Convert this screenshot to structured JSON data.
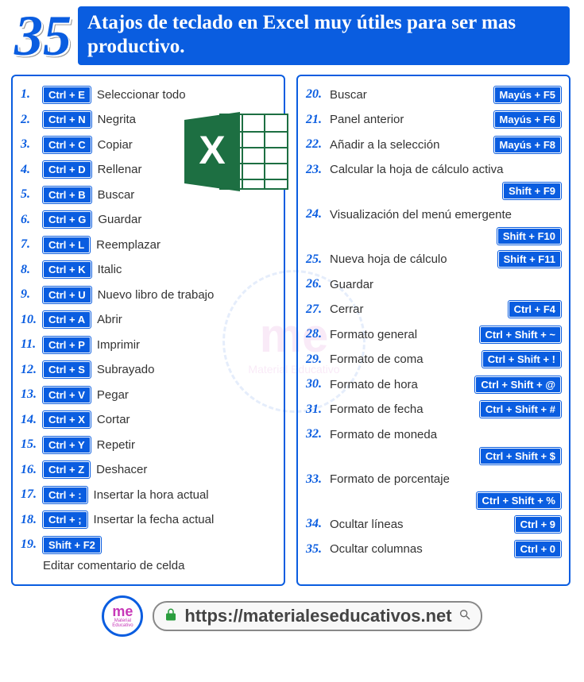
{
  "header": {
    "number": "35",
    "title": "Atajos de teclado en Excel muy útiles para ser mas productivo."
  },
  "leftColumn": [
    {
      "num": "1.",
      "key": "Ctrl + E",
      "desc": "Seleccionar todo"
    },
    {
      "num": "2.",
      "key": "Ctrl + N",
      "desc": "Negrita"
    },
    {
      "num": "3.",
      "key": "Ctrl + C",
      "desc": "Copiar"
    },
    {
      "num": "4.",
      "key": "Ctrl + D",
      "desc": "Rellenar"
    },
    {
      "num": "5.",
      "key": "Ctrl + B",
      "desc": "Buscar"
    },
    {
      "num": "6.",
      "key": "Ctrl + G",
      "desc": "Guardar"
    },
    {
      "num": "7.",
      "key": "Ctrl + L",
      "desc": "Reemplazar"
    },
    {
      "num": "8.",
      "key": "Ctrl + K",
      "desc": "Italic"
    },
    {
      "num": "9.",
      "key": "Ctrl + U",
      "desc": "Nuevo libro de trabajo"
    },
    {
      "num": "10.",
      "key": "Ctrl + A",
      "desc": "Abrir"
    },
    {
      "num": "11.",
      "key": "Ctrl + P",
      "desc": "Imprimir"
    },
    {
      "num": "12.",
      "key": "Ctrl + S",
      "desc": "Subrayado"
    },
    {
      "num": "13.",
      "key": "Ctrl + V",
      "desc": "Pegar"
    },
    {
      "num": "14.",
      "key": "Ctrl + X",
      "desc": "Cortar"
    },
    {
      "num": "15.",
      "key": "Ctrl + Y",
      "desc": "Repetir"
    },
    {
      "num": "16.",
      "key": "Ctrl + Z",
      "desc": "Deshacer"
    },
    {
      "num": "17.",
      "key": "Ctrl + :",
      "desc": "Insertar la hora actual"
    },
    {
      "num": "18.",
      "key": "Ctrl + ;",
      "desc": "Insertar la fecha actual"
    },
    {
      "num": "19.",
      "key": "Shift + F2",
      "desc": ""
    }
  ],
  "leftExtra": "Editar comentario de celda",
  "rightColumn": [
    {
      "num": "20.",
      "desc": "Buscar",
      "key": "Mayús + F5",
      "layout": "key-right"
    },
    {
      "num": "21.",
      "desc": "Panel anterior",
      "key": "Mayús + F6",
      "layout": "key-right"
    },
    {
      "num": "22.",
      "desc": "Añadir a la selección",
      "key": "Mayús + F8",
      "layout": "key-right"
    },
    {
      "num": "23.",
      "desc": "Calcular la hoja de cálculo activa",
      "key": "",
      "layout": "desc-only"
    },
    {
      "num": "",
      "desc": "",
      "key": "Shift + F9",
      "layout": "key-solo"
    },
    {
      "num": "24.",
      "desc": "Visualización del menú emergente",
      "key": "",
      "layout": "desc-only"
    },
    {
      "num": "",
      "desc": "",
      "key": "Shift + F10",
      "layout": "key-solo"
    },
    {
      "num": "25.",
      "desc": "Nueva hoja de cálculo",
      "key": "Shift + F11",
      "layout": "key-right"
    },
    {
      "num": "26.",
      "desc": "Guardar",
      "key": "",
      "layout": "desc-only"
    },
    {
      "num": "27.",
      "desc": "Cerrar",
      "key": "Ctrl + F4",
      "layout": "key-right"
    },
    {
      "num": "28.",
      "desc": "Formato general",
      "key": "Ctrl + Shift + ~",
      "layout": "key-right"
    },
    {
      "num": "29.",
      "desc": "Formato de coma",
      "key": "Ctrl + Shift + !",
      "layout": "key-right"
    },
    {
      "num": "30.",
      "desc": "Formato de hora",
      "key": "Ctrl + Shift + @",
      "layout": "key-right"
    },
    {
      "num": "31.",
      "desc": "Formato de fecha",
      "key": "Ctrl + Shift + #",
      "layout": "key-right"
    },
    {
      "num": "32.",
      "desc": "Formato de moneda",
      "key": "",
      "layout": "desc-only"
    },
    {
      "num": "",
      "desc": "",
      "key": "Ctrl + Shift + $",
      "layout": "key-solo"
    },
    {
      "num": "33.",
      "desc": "Formato de porcentaje",
      "key": "",
      "layout": "desc-only"
    },
    {
      "num": "",
      "desc": "",
      "key": "Ctrl + Shift + %",
      "layout": "key-solo"
    },
    {
      "num": "34.",
      "desc": "Ocultar líneas",
      "key": "Ctrl + 9",
      "layout": "key-right"
    },
    {
      "num": "35.",
      "desc": "Ocultar columnas",
      "key": "Ctrl + 0",
      "layout": "key-right"
    }
  ],
  "excelIconLabel": "X",
  "watermark": {
    "me": "me",
    "txt": "Material Educativo"
  },
  "footer": {
    "logoMe": "me",
    "logoTxt": "Material Educativo",
    "url": "https://materialeseducativos.net"
  }
}
